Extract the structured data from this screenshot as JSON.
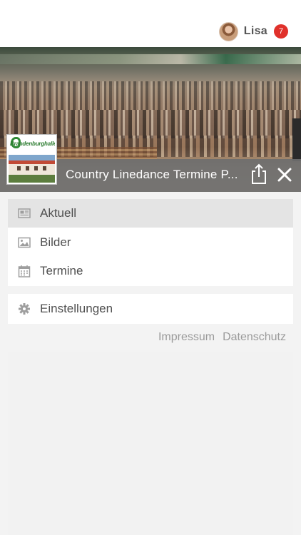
{
  "user": {
    "name": "Lisa",
    "notification_count": "7"
  },
  "header": {
    "title": "Country Linedance Termine P...",
    "logo_text": "Brandenburghalle"
  },
  "menu": {
    "items": [
      {
        "label": "Aktuell",
        "icon": "newspaper-icon",
        "active": true
      },
      {
        "label": "Bilder",
        "icon": "image-icon",
        "active": false
      },
      {
        "label": "Termine",
        "icon": "calendar-icon",
        "active": false
      }
    ],
    "settings": {
      "label": "Einstellungen",
      "icon": "gear-icon"
    }
  },
  "footer": {
    "impressum": "Impressum",
    "datenschutz": "Datenschutz"
  },
  "colors": {
    "badge": "#e0312b",
    "title_bar": "#6e6e6e",
    "active_item": "#e4e4e4",
    "text": "#505050",
    "link": "#9a9a9a"
  }
}
